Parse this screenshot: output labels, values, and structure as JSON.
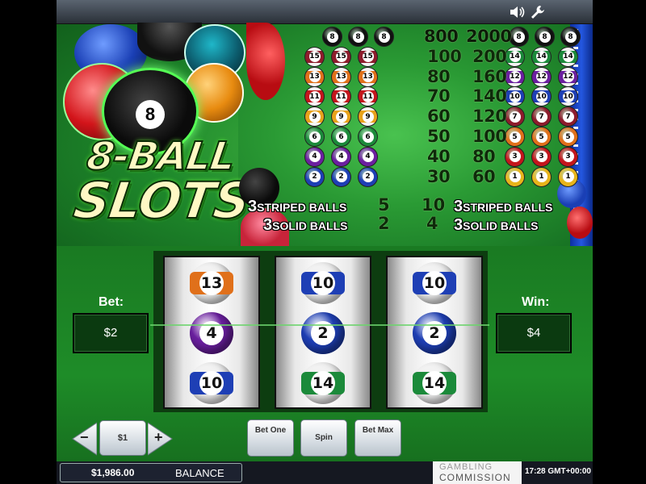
{
  "game_title": {
    "line1": "8-BALL",
    "line2": "SLOTS"
  },
  "topbar": {
    "icons": [
      "speaker-icon",
      "wrench-icon"
    ]
  },
  "paytable": {
    "rows": [
      {
        "ball": "8",
        "color": "#111111",
        "stripe": false,
        "pay1": "800",
        "pay2": "2000",
        "ball_right": "8",
        "color_right": "#111111",
        "stripe_right": false
      },
      {
        "ball": "15",
        "color": "#8e1c2c",
        "stripe": true,
        "pay1": "100",
        "pay2": "200",
        "ball_right": "14",
        "color_right": "#1b8a3a",
        "stripe_right": true
      },
      {
        "ball": "13",
        "color": "#e0701a",
        "stripe": true,
        "pay1": "80",
        "pay2": "160",
        "ball_right": "12",
        "color_right": "#6b1fa0",
        "stripe_right": true
      },
      {
        "ball": "11",
        "color": "#c4161c",
        "stripe": true,
        "pay1": "70",
        "pay2": "140",
        "ball_right": "10",
        "color_right": "#1e3fb5",
        "stripe_right": true
      },
      {
        "ball": "9",
        "color": "#e8a21a",
        "stripe": true,
        "pay1": "60",
        "pay2": "120",
        "ball_right": "7",
        "color_right": "#8e1c2c",
        "stripe_right": false
      },
      {
        "ball": "6",
        "color": "#1b8a3a",
        "stripe": false,
        "pay1": "50",
        "pay2": "100",
        "ball_right": "5",
        "color_right": "#e0701a",
        "stripe_right": false
      },
      {
        "ball": "4",
        "color": "#6b1fa0",
        "stripe": false,
        "pay1": "40",
        "pay2": "80",
        "ball_right": "3",
        "color_right": "#c4161c",
        "stripe_right": false
      },
      {
        "ball": "2",
        "color": "#1e3fb5",
        "stripe": false,
        "pay1": "30",
        "pay2": "60",
        "ball_right": "1",
        "color_right": "#e8b41a",
        "stripe_right": false
      }
    ],
    "striped": {
      "count": "3",
      "label": "STRIPED BALLS",
      "pay1": "5",
      "pay2": "10"
    },
    "solid": {
      "count": "3",
      "label": "SOLID BALLS",
      "pay1": "2",
      "pay2": "4"
    }
  },
  "reels": [
    [
      {
        "n": "13",
        "color": "#e0701a",
        "stripe": true
      },
      {
        "n": "4",
        "color": "#6b1fa0",
        "stripe": false
      },
      {
        "n": "10",
        "color": "#1e3fb5",
        "stripe": true
      }
    ],
    [
      {
        "n": "10",
        "color": "#1e3fb5",
        "stripe": true
      },
      {
        "n": "2",
        "color": "#1e3fb5",
        "stripe": false
      },
      {
        "n": "14",
        "color": "#1b8a3a",
        "stripe": true
      }
    ],
    [
      {
        "n": "10",
        "color": "#1e3fb5",
        "stripe": true
      },
      {
        "n": "2",
        "color": "#1e3fb5",
        "stripe": false
      },
      {
        "n": "14",
        "color": "#1b8a3a",
        "stripe": true
      }
    ]
  ],
  "bet": {
    "label": "Bet:",
    "value": "$2"
  },
  "win": {
    "label": "Win:",
    "value": "$4"
  },
  "controls": {
    "minus": "−",
    "coin_value": "$1",
    "plus": "+",
    "bet_one": "Bet One",
    "spin": "Spin",
    "bet_max": "Bet Max"
  },
  "footer": {
    "balance_amount": "$1,986.00",
    "balance_label": "BALANCE",
    "commission_line1": "GAMBLING",
    "commission_line2": "COMMISSION",
    "time": "17:28 GMT+00:00"
  }
}
